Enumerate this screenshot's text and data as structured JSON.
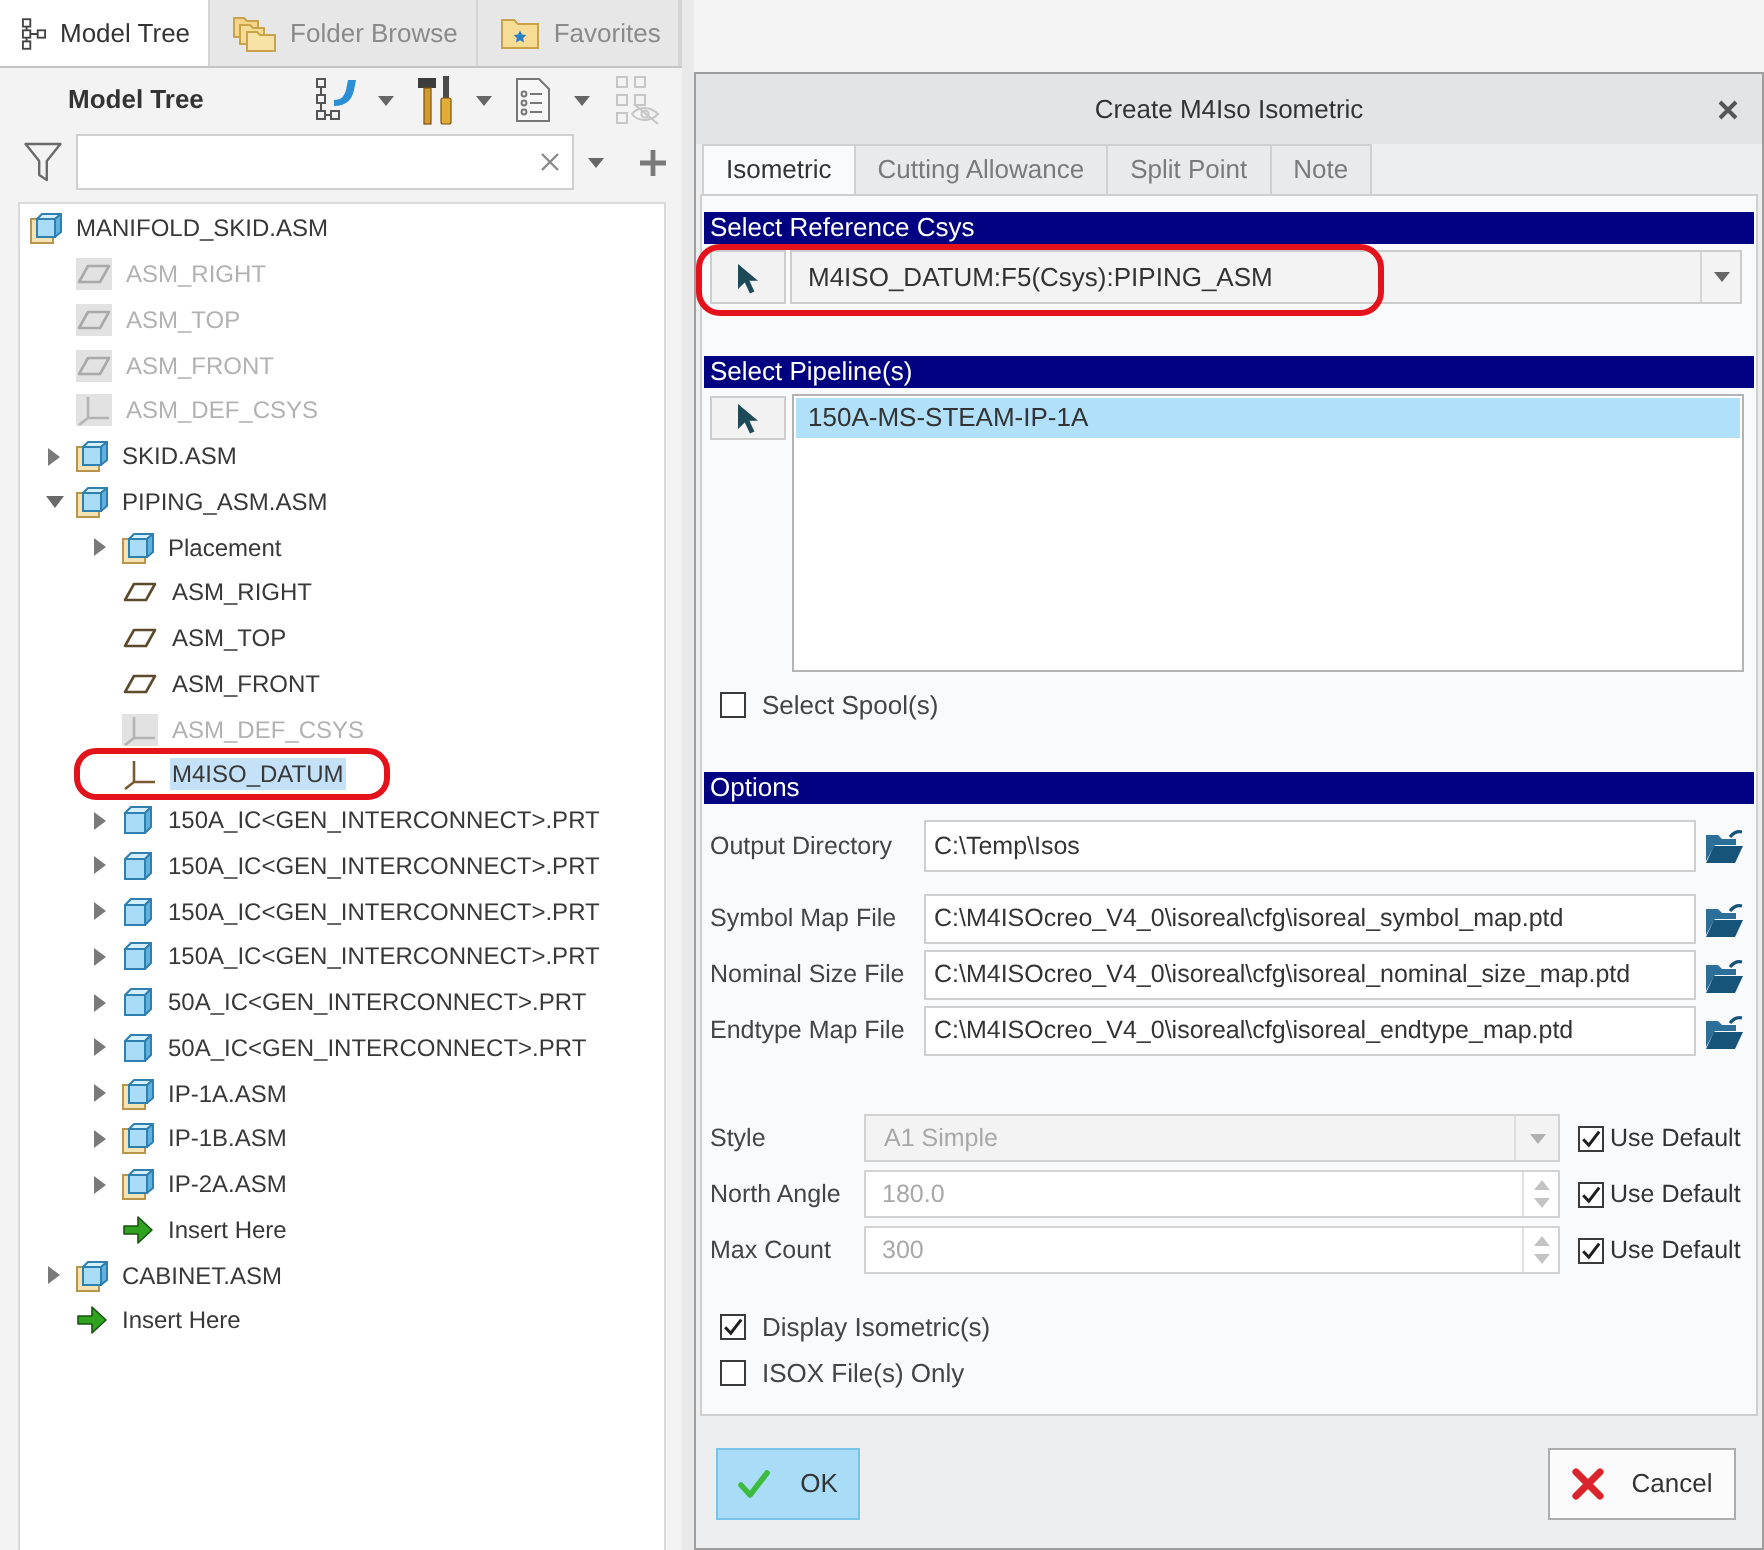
{
  "left_panel": {
    "tabs": [
      {
        "label": "Model Tree",
        "kind": "tree",
        "selected": true
      },
      {
        "label": "Folder Browse",
        "kind": "folders",
        "selected": false
      },
      {
        "label": "Favorites",
        "kind": "favorites",
        "selected": false
      }
    ],
    "toolbar": {
      "title": "Model Tree"
    },
    "tree": [
      {
        "label": "MANIFOLD_SKID.ASM",
        "kind": "assembly",
        "dimmed": false,
        "selected": false,
        "circled": false,
        "children": [
          {
            "label": "ASM_RIGHT",
            "kind": "plane",
            "dimmed": true,
            "selected": false,
            "circled": false
          },
          {
            "label": "ASM_TOP",
            "kind": "plane",
            "dimmed": true,
            "selected": false,
            "circled": false
          },
          {
            "label": "ASM_FRONT",
            "kind": "plane",
            "dimmed": true,
            "selected": false,
            "circled": false
          },
          {
            "label": "ASM_DEF_CSYS",
            "kind": "csys",
            "dimmed": true,
            "selected": false,
            "circled": false
          },
          {
            "label": "SKID.ASM",
            "kind": "assembly",
            "expanded": false,
            "dimmed": false,
            "selected": false,
            "circled": false
          },
          {
            "label": "PIPING_ASM.ASM",
            "kind": "assembly",
            "expanded": true,
            "dimmed": false,
            "selected": false,
            "circled": false,
            "children": [
              {
                "label": "Placement",
                "kind": "assembly",
                "expanded": false,
                "dimmed": false,
                "selected": false,
                "circled": false
              },
              {
                "label": "ASM_RIGHT",
                "kind": "plane",
                "dimmed": false,
                "selected": false,
                "circled": false
              },
              {
                "label": "ASM_TOP",
                "kind": "plane",
                "dimmed": false,
                "selected": false,
                "circled": false
              },
              {
                "label": "ASM_FRONT",
                "kind": "plane",
                "dimmed": false,
                "selected": false,
                "circled": false
              },
              {
                "label": "ASM_DEF_CSYS",
                "kind": "csys",
                "dimmed": true,
                "selected": false,
                "circled": false
              },
              {
                "label": "M4ISO_DATUM",
                "kind": "csys",
                "dimmed": false,
                "selected": true,
                "circled": true
              },
              {
                "label": "150A_IC<GEN_INTERCONNECT>.PRT",
                "kind": "part",
                "expanded": false,
                "dimmed": false,
                "selected": false,
                "circled": false
              },
              {
                "label": "150A_IC<GEN_INTERCONNECT>.PRT",
                "kind": "part",
                "expanded": false,
                "dimmed": false,
                "selected": false,
                "circled": false
              },
              {
                "label": "150A_IC<GEN_INTERCONNECT>.PRT",
                "kind": "part",
                "expanded": false,
                "dimmed": false,
                "selected": false,
                "circled": false
              },
              {
                "label": "150A_IC<GEN_INTERCONNECT>.PRT",
                "kind": "part",
                "expanded": false,
                "dimmed": false,
                "selected": false,
                "circled": false
              },
              {
                "label": "50A_IC<GEN_INTERCONNECT>.PRT",
                "kind": "part",
                "expanded": false,
                "dimmed": false,
                "selected": false,
                "circled": false
              },
              {
                "label": "50A_IC<GEN_INTERCONNECT>.PRT",
                "kind": "part",
                "expanded": false,
                "dimmed": false,
                "selected": false,
                "circled": false
              },
              {
                "label": "IP-1A.ASM",
                "kind": "assembly",
                "expanded": false,
                "dimmed": false,
                "selected": false,
                "circled": false
              },
              {
                "label": "IP-1B.ASM",
                "kind": "assembly",
                "expanded": false,
                "dimmed": false,
                "selected": false,
                "circled": false
              },
              {
                "label": "IP-2A.ASM",
                "kind": "assembly",
                "expanded": false,
                "dimmed": false,
                "selected": false,
                "circled": false
              },
              {
                "label": "Insert Here",
                "kind": "insert",
                "dimmed": false,
                "selected": false,
                "circled": false
              }
            ]
          },
          {
            "label": "CABINET.ASM",
            "kind": "assembly",
            "expanded": false,
            "dimmed": false,
            "selected": false,
            "circled": false
          },
          {
            "label": "Insert Here",
            "kind": "insert",
            "dimmed": false,
            "selected": false,
            "circled": false
          }
        ]
      }
    ]
  },
  "dialog": {
    "title": "Create M4Iso Isometric",
    "tabs": [
      {
        "label": "Isometric",
        "selected": true
      },
      {
        "label": "Cutting Allowance",
        "selected": false
      },
      {
        "label": "Split Point",
        "selected": false
      },
      {
        "label": "Note",
        "selected": false
      }
    ],
    "reference_csys": {
      "heading": "Select Reference Csys",
      "value": "M4ISO_DATUM:F5(Csys):PIPING_ASM",
      "circled": true
    },
    "pipelines": {
      "heading": "Select Pipeline(s)",
      "items": [
        {
          "label": "150A-MS-STEAM-IP-1A",
          "selected": true
        }
      ]
    },
    "select_spools": {
      "label": "Select Spool(s)",
      "checked": false
    },
    "options": {
      "heading": "Options",
      "files": [
        {
          "label": "Output Directory",
          "value": "C:\\Temp\\Isos"
        },
        {
          "label": "Symbol Map File",
          "value": "C:\\M4ISOcreo_V4_0\\isoreal\\cfg\\isoreal_symbol_map.ptd"
        },
        {
          "label": "Nominal Size File",
          "value": "C:\\M4ISOcreo_V4_0\\isoreal\\cfg\\isoreal_nominal_size_map.ptd"
        },
        {
          "label": "Endtype Map File",
          "value": "C:\\M4ISOcreo_V4_0\\isoreal\\cfg\\isoreal_endtype_map.ptd"
        }
      ],
      "settings": [
        {
          "label": "Style",
          "kind": "dropdown",
          "value": "A1 Simple",
          "disabled": true,
          "use_default": {
            "label": "Use Default",
            "checked": true
          }
        },
        {
          "label": "North Angle",
          "kind": "spinner",
          "value": "180.0",
          "disabled": true,
          "use_default": {
            "label": "Use Default",
            "checked": true
          }
        },
        {
          "label": "Max Count",
          "kind": "spinner",
          "value": "300",
          "disabled": true,
          "use_default": {
            "label": "Use Default",
            "checked": true
          }
        }
      ],
      "flags": [
        {
          "label": "Display Isometric(s)",
          "checked": true
        },
        {
          "label": "ISOX File(s) Only",
          "checked": false
        }
      ]
    },
    "buttons": [
      {
        "label": "OK",
        "kind": "ok",
        "focused": true
      },
      {
        "label": "Cancel",
        "kind": "cancel",
        "focused": false
      }
    ]
  }
}
